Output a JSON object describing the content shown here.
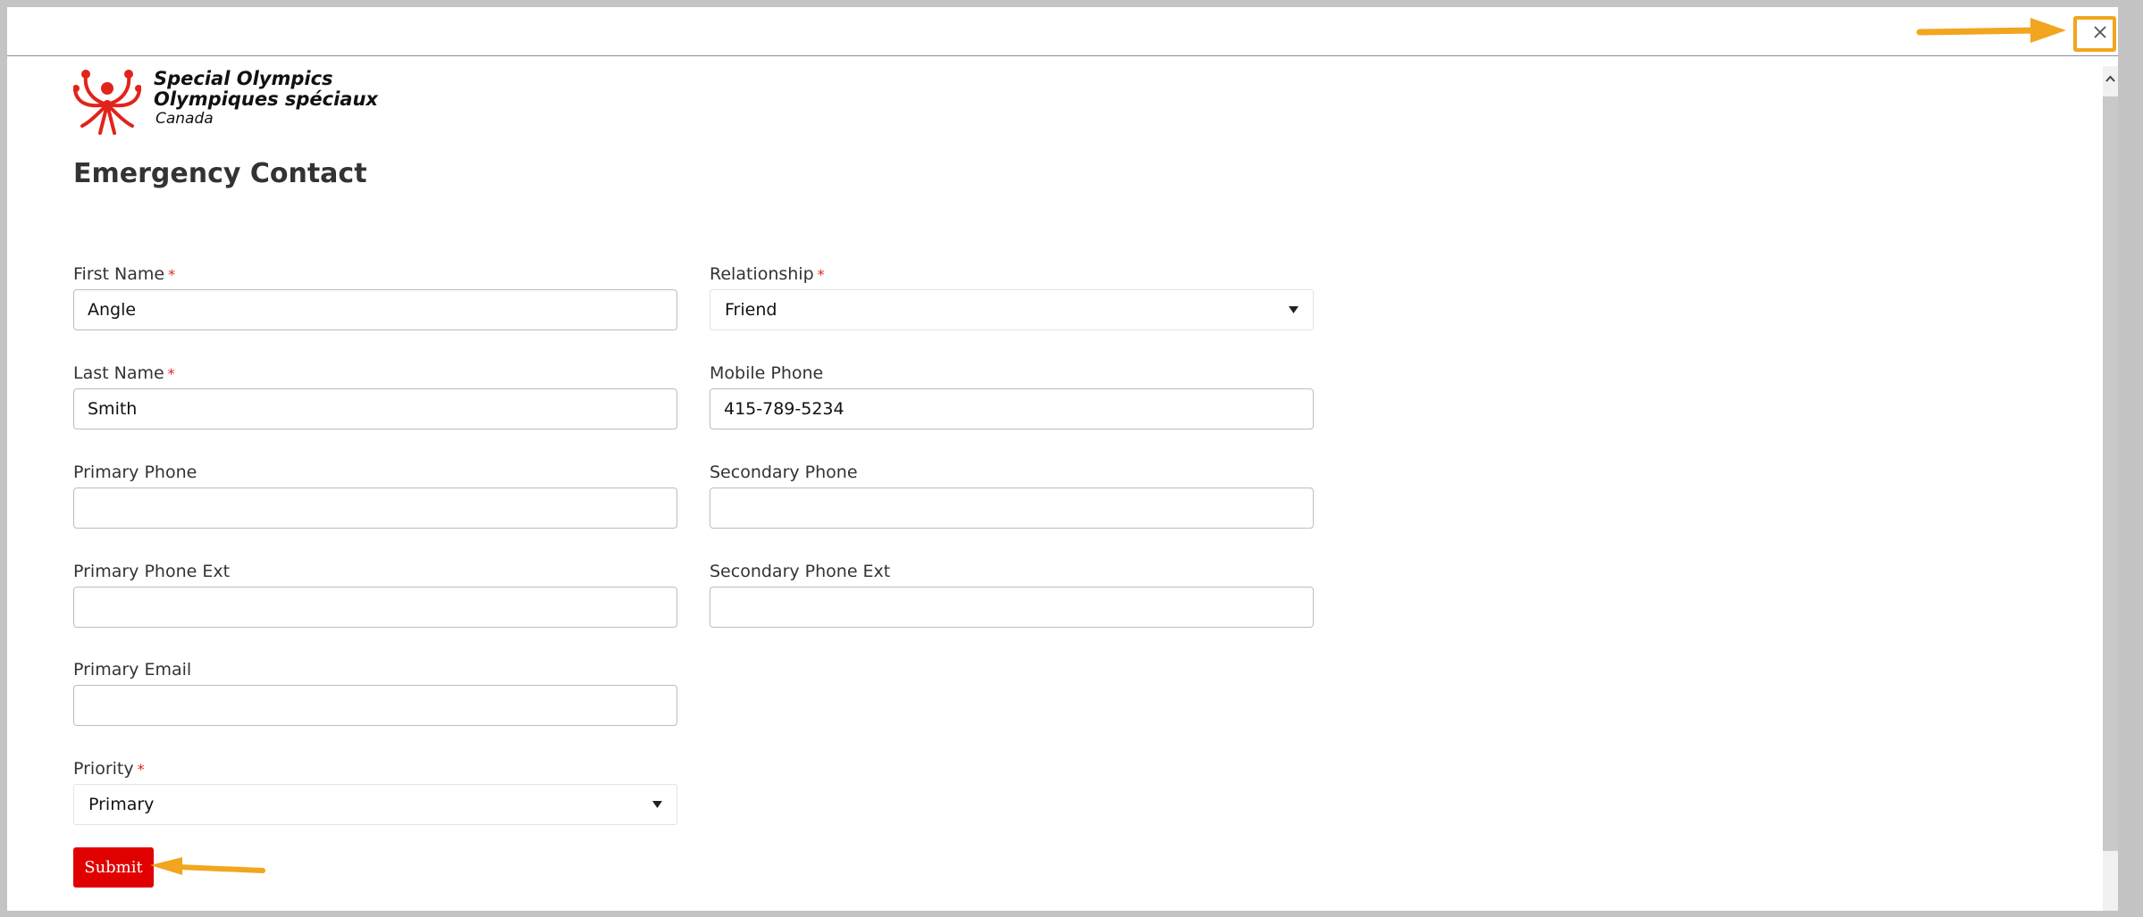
{
  "logo": {
    "line1": "Special Olympics",
    "line2": "Olympiques spéciaux",
    "line3": "Canada",
    "brand_color": "#e2231a"
  },
  "form": {
    "title": "Emergency Contact",
    "required_marker": "*",
    "first_name": {
      "label": "First Name",
      "value": "Angle"
    },
    "last_name": {
      "label": "Last Name",
      "value": "Smith"
    },
    "primary_phone": {
      "label": "Primary Phone",
      "value": ""
    },
    "primary_phone_ext": {
      "label": "Primary Phone Ext",
      "value": ""
    },
    "primary_email": {
      "label": "Primary Email",
      "value": ""
    },
    "priority": {
      "label": "Priority",
      "value": "Primary"
    },
    "relationship": {
      "label": "Relationship",
      "value": "Friend"
    },
    "mobile_phone": {
      "label": "Mobile Phone",
      "value": "415-789-5234"
    },
    "secondary_phone": {
      "label": "Secondary Phone",
      "value": ""
    },
    "secondary_phone_ext": {
      "label": "Secondary Phone Ext",
      "value": ""
    },
    "submit_label": "Submit"
  },
  "icons": {
    "close": "close-icon",
    "dropdown": "caret-down-icon",
    "scroll_up": "chevron-up-icon"
  },
  "colors": {
    "submit": "#e10000",
    "annotation_arrow": "#f2a51e",
    "required": "#e2231a"
  }
}
